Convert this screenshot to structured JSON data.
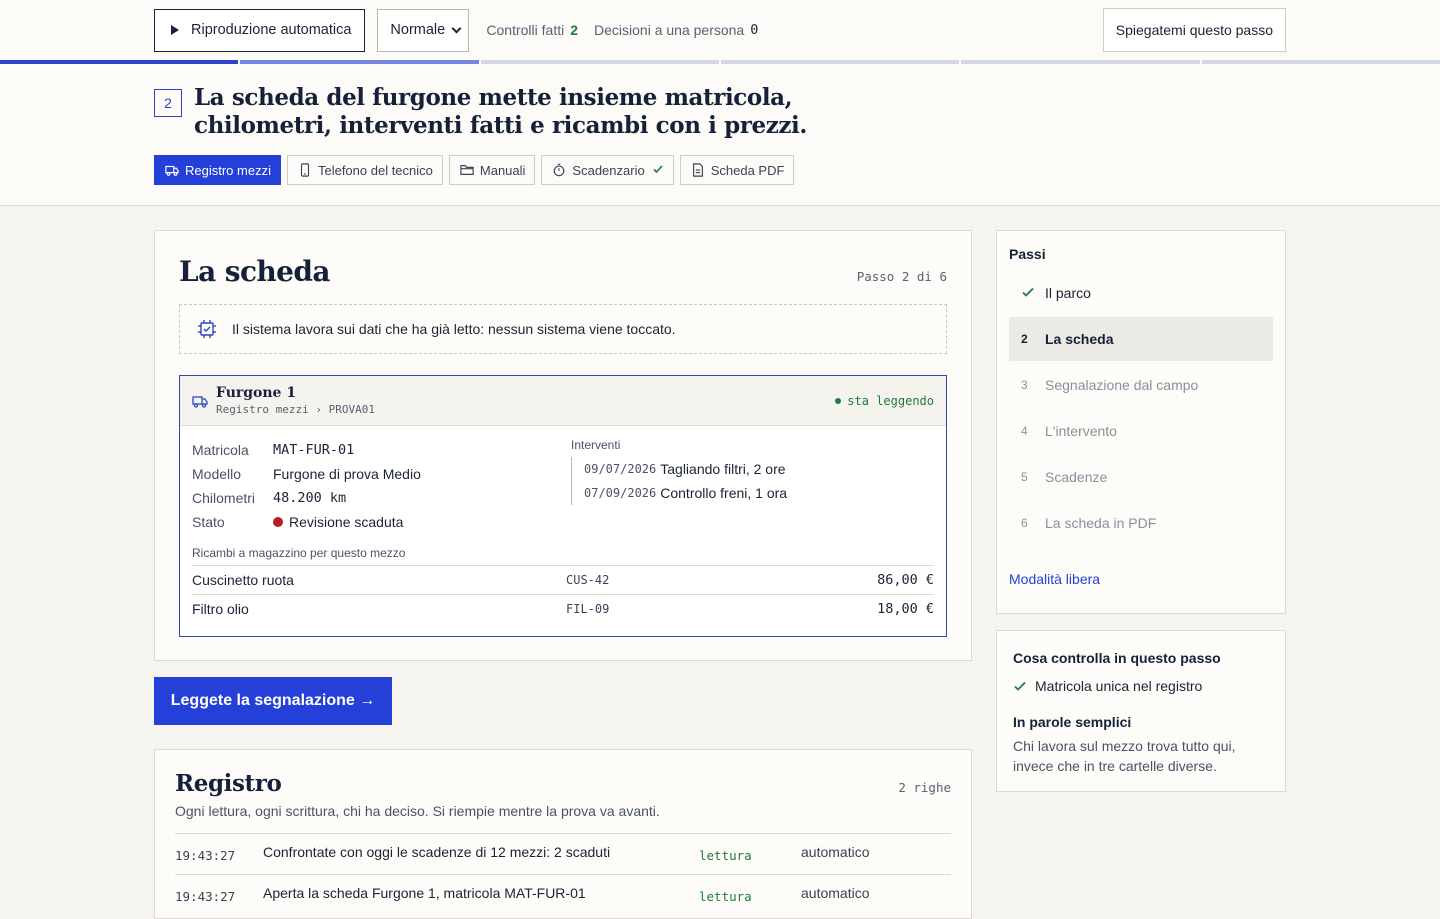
{
  "toolbar": {
    "autoplay_label": "Riproduzione automatica",
    "speed_value": "Normale",
    "checks_label": "Controlli fatti",
    "checks_count": "2",
    "decisions_label": "Decisioni a una persona",
    "decisions_count": "0",
    "explain_label": "Spiegatemi questo passo"
  },
  "progress": {
    "current_step": 2,
    "total_steps": 6
  },
  "heading": {
    "step_number": "2",
    "title": "La scheda del furgone mette insieme matricola, chilometri, interventi fatti e ricambi con i prezzi."
  },
  "tabs": [
    {
      "label": "Registro mezzi",
      "icon": "truck-icon",
      "active": true
    },
    {
      "label": "Telefono del tecnico",
      "icon": "phone-icon"
    },
    {
      "label": "Manuali",
      "icon": "folder-icon"
    },
    {
      "label": "Scadenzario",
      "icon": "stopwatch-icon",
      "checked": true
    },
    {
      "label": "Scheda PDF",
      "icon": "document-icon"
    }
  ],
  "main": {
    "title": "La scheda",
    "step_info": "Passo 2 di 6",
    "notice": "Il sistema lavora sui dati che ha già letto: nessun sistema viene toccato.",
    "vehicle": {
      "name": "Furgone 1",
      "path": "Registro mezzi › PROVA01",
      "status": "sta leggendo",
      "fields": [
        {
          "key": "Matricola",
          "value": "MAT-FUR-01"
        },
        {
          "key": "Modello",
          "value": "Furgone di prova Medio"
        },
        {
          "key": "Chilometri",
          "value": "48.200 km"
        },
        {
          "key": "Stato",
          "value": "Revisione scaduta"
        }
      ],
      "interventions_label": "Interventi",
      "interventions": [
        {
          "date": "09/07/2026",
          "text": "Tagliando filtri, 2 ore"
        },
        {
          "date": "07/09/2026",
          "text": "Controllo freni, 1 ora"
        }
      ],
      "parts_label": "Ricambi a magazzino per questo mezzo",
      "parts": [
        {
          "name": "Cuscinetto ruota",
          "code": "CUS-42",
          "price": "86,00 €"
        },
        {
          "name": "Filtro olio",
          "code": "FIL-09",
          "price": "18,00 €"
        }
      ]
    }
  },
  "cta_label": "Leggete la segnalazione →",
  "log": {
    "title": "Registro",
    "rows_count": "2 righe",
    "subtitle": "Ogni lettura, ogni scrittura, chi ha deciso. Si riempie mentre la prova va avanti.",
    "rows": [
      {
        "time": "19:43:27",
        "desc": "Confrontate con oggi le scadenze di 12 mezzi: 2 scaduti",
        "kind": "lettura",
        "who": "automatico"
      },
      {
        "time": "19:43:27",
        "desc": "Aperta la scheda Furgone 1, matricola MAT-FUR-01",
        "kind": "lettura",
        "who": "automatico"
      }
    ]
  },
  "sidebar": {
    "title": "Passi",
    "steps": [
      {
        "num": "",
        "label": "Il parco",
        "state": "done"
      },
      {
        "num": "2",
        "label": "La scheda",
        "state": "current"
      },
      {
        "num": "3",
        "label": "Segnalazione dal campo",
        "state": "todo"
      },
      {
        "num": "4",
        "label": "L'intervento",
        "state": "todo"
      },
      {
        "num": "5",
        "label": "Scadenze",
        "state": "todo"
      },
      {
        "num": "6",
        "label": "La scheda in PDF",
        "state": "todo"
      }
    ],
    "free_mode": "Modalità libera"
  },
  "checks": {
    "title": "Cosa controlla in questo passo",
    "item": "Matricola unica nel registro",
    "plain_title": "In parole semplici",
    "plain_text": "Chi lavora sul mezzo trova tutto qui, invece che in tre cartelle diverse."
  },
  "colors": {
    "accent": "#2540d8",
    "ok": "#1f7a3d",
    "alert": "#b82020"
  }
}
